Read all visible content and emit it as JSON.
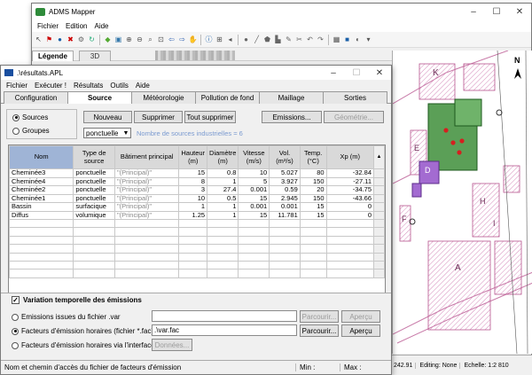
{
  "app": {
    "title": "ADMS Mapper",
    "menu": [
      "Fichier",
      "Edition",
      "Aide"
    ],
    "legend_tab": "Légende",
    "second_tab": "3D",
    "status": {
      "coord": "242.91",
      "editing": "Editing: None",
      "scale": "Echelle: 1:2 810"
    }
  },
  "map": {
    "north_label": "N",
    "building_labels": [
      "K",
      "E",
      "D",
      "F",
      "H",
      "I",
      "A"
    ]
  },
  "dialog": {
    "title": ".\\résultats.APL",
    "menu": [
      "Fichier",
      "Exécuter !",
      "Résultats",
      "Outils",
      "Aide"
    ],
    "tabs": [
      "Configuration",
      "Source",
      "Météorologie",
      "Pollution de fond",
      "Maillage",
      "Sorties"
    ],
    "source_mode": [
      "Sources",
      "Groupes"
    ],
    "buttons": {
      "new": "Nouveau",
      "delete": "Supprimer",
      "delete_all": "Tout supprimer",
      "emissions": "Emissions...",
      "geometry": "Géométrie..."
    },
    "type_select": "ponctuelle",
    "industrial_count": "Nombre de sources industrielles = 6",
    "table": {
      "headers": [
        "Nom",
        "Type de source",
        "Bâtiment principal",
        "Hauteur (m)",
        "Diamètre (m)",
        "Vitesse (m/s)",
        "Vol. (m³/s)",
        "Temp. (°C)",
        "Xp (m)"
      ],
      "rows": [
        [
          "Cheminée3",
          "ponctuelle",
          "\"(Principal)\"",
          "15",
          "0.8",
          "10",
          "5.027",
          "80",
          "-32.84"
        ],
        [
          "Cheminée4",
          "ponctuelle",
          "\"(Principal)\"",
          "8",
          "1",
          "5",
          "3.927",
          "150",
          "-27.11"
        ],
        [
          "Cheminée2",
          "ponctuelle",
          "\"(Principal)\"",
          "3",
          "27.4",
          "0.001",
          "0.59",
          "20",
          "-34.75"
        ],
        [
          "Cheminée1",
          "ponctuelle",
          "\"(Principal)\"",
          "10",
          "0.5",
          "15",
          "2.945",
          "150",
          "-43.66"
        ],
        [
          "Bassin",
          "surfacique",
          "\"(Principal)\"",
          "1",
          "1",
          "0.001",
          "0.001",
          "15",
          "0"
        ],
        [
          "Diffus",
          "volumique",
          "\"(Principal)\"",
          "1.25",
          "1",
          "15",
          "11.781",
          "15",
          "0"
        ]
      ]
    },
    "temporal": {
      "label": "Variation temporelle des émissions",
      "opt1": "Emissions issues du fichier .var",
      "opt2": "Facteurs d'émission horaires (fichier *.fac)",
      "opt3": "Facteurs d'émission horaires via l'interface",
      "fac_value": ".\\var.fac",
      "browse": "Parcourir...",
      "preview": "Aperçu",
      "data_btn": "Données..."
    },
    "status": {
      "hint": "Nom et chemin d'accès du fichier de facteurs d'émission",
      "min": "Min :",
      "max": "Max :"
    }
  }
}
